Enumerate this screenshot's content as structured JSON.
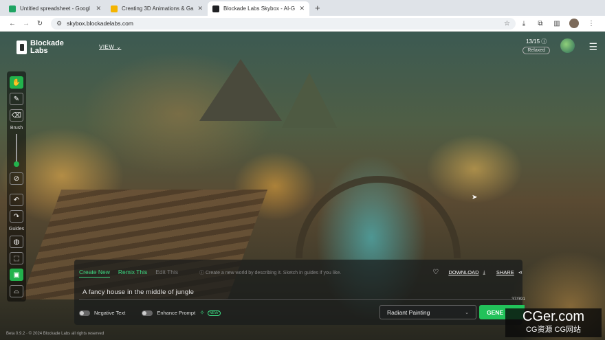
{
  "browser": {
    "tabs": [
      {
        "title": "Untitled spreadsheet - Googl",
        "favicon_color": "#1fa463",
        "active": false
      },
      {
        "title": "Creating 3D Animations & Ga",
        "favicon_color": "#f4b400",
        "active": false
      },
      {
        "title": "Blockade Labs Skybox - AI-G",
        "favicon_color": "#202124",
        "active": true
      }
    ],
    "new_tab": "+",
    "url": "skybox.blockadelabs.com"
  },
  "app": {
    "logo_line1": "Blockade",
    "logo_line2": "Labs",
    "view_label": "VIEW",
    "credits": "13/15",
    "credits_mode": "Relaxed",
    "sidebar": {
      "brush_label": "Brush",
      "guides_label": "Guides",
      "brush_size": 0.0
    },
    "tabs": [
      "Create New",
      "Remix This",
      "Edit This"
    ],
    "hint": "Create a new world by describing it. Sketch in guides if you like.",
    "download_label": "DOWNLOAD",
    "share_label": "SHARE",
    "prompt": "A fancy house in the middle of jungle",
    "char_count": "37/391",
    "negative_text_label": "Negative Text",
    "enhance_prompt_label": "Enhance Prompt",
    "new_badge": "NEW",
    "style": "Radiant Painting",
    "generate_label": "GENE",
    "footer": "Beta 0.9.2 · © 2024 Blockade Labs all rights reserved",
    "accent": "#22c25a"
  },
  "watermark": {
    "line1": "CGer.com",
    "line2": "CG资源 CG网站"
  }
}
